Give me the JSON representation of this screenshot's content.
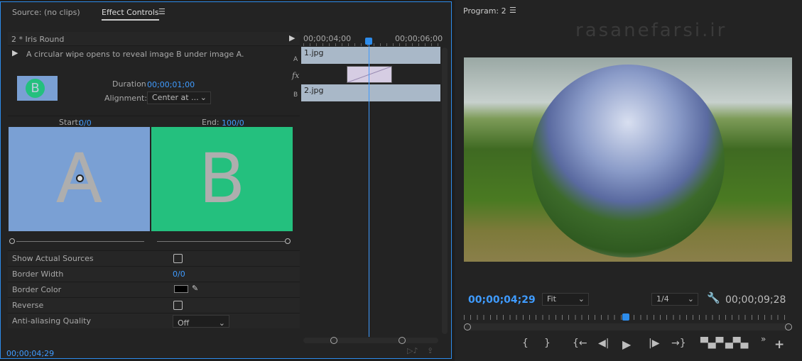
{
  "left_panel": {
    "tabs": [
      {
        "label": "Source: (no clips)"
      },
      {
        "label": "Effect Controls",
        "active": true
      }
    ],
    "menu_icon": "hamburger-icon",
    "effect_title": "2 * Iris Round",
    "description": "A circular wipe opens to reveal image B under image A.",
    "duration_label": "Duration",
    "duration_value": "00;00;01;00",
    "alignment_label": "Alignment:",
    "alignment_value": "Center at ...",
    "start_label": "Start:",
    "start_value": "0/0",
    "end_label": "End:",
    "end_value": "100/0",
    "preview_a": "A",
    "preview_b": "B",
    "thumb_letter": "B",
    "properties": [
      {
        "label": "Show Actual Sources",
        "type": "checkbox",
        "checked": false
      },
      {
        "label": "Border Width",
        "type": "value",
        "value": "0/0"
      },
      {
        "label": "Border Color",
        "type": "color",
        "value": "#000000"
      },
      {
        "label": "Reverse",
        "type": "checkbox",
        "checked": false
      },
      {
        "label": "Anti-aliasing Quality",
        "type": "dropdown",
        "value": "Off"
      }
    ],
    "timeline": {
      "time_left": "00;00;04;00",
      "time_right": "00;00;06;00",
      "track_a_label": "A",
      "track_b_label": "B",
      "clip_a": "1.jpg",
      "clip_b": "2.jpg",
      "fx_label": "fx"
    },
    "current_time": "00;00;04;29"
  },
  "program": {
    "title": "Program: 2",
    "watermark": "rasanefarsi.ir",
    "current_time": "00;00;04;29",
    "zoom": "Fit",
    "resolution": "1/4",
    "duration": "00;00;09;28",
    "playhead_fraction": 0.5,
    "controls": [
      "mark-in",
      "mark-out",
      "go-to-in",
      "step-back",
      "play",
      "step-forward",
      "go-to-out",
      "lift",
      "extract",
      "more",
      "add"
    ]
  },
  "colors": {
    "accent": "#2d8ceb",
    "preview_a": "#7aa0d4",
    "preview_b": "#24c07e"
  }
}
